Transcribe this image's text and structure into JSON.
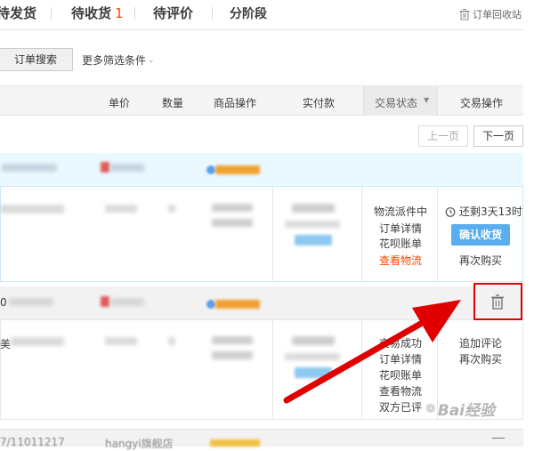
{
  "tabs": [
    {
      "label": "待发货",
      "count": ""
    },
    {
      "label": "待收货",
      "count": "1"
    },
    {
      "label": "待评价",
      "count": ""
    },
    {
      "label": "分阶段",
      "count": ""
    }
  ],
  "recycle_label": "订单回收站",
  "search_button": "订单搜索",
  "more_filters": "更多筛选条件",
  "columns": {
    "price": "单价",
    "qty": "数量",
    "product_ops": "商品操作",
    "paid": "实付款",
    "status": "交易状态",
    "ops": "交易操作"
  },
  "pager": {
    "prev": "上一页",
    "next": "下一页"
  },
  "order1": {
    "status_lines": [
      "物流派件中",
      "订单详情",
      "花呗账单",
      "查看物流"
    ],
    "countdown": "还剩3天13时",
    "confirm": "确认收货",
    "rebuy": "再次购买"
  },
  "order2": {
    "left_char": "0",
    "left_char2": "美",
    "status_lines": [
      "交易成功",
      "订单详情",
      "花呗账单",
      "查看物流",
      "双方已评"
    ],
    "add_review": "追加评论",
    "rebuy": "再次购买"
  },
  "order3": {
    "left_text": "7/11011217",
    "mid_text": "hangyi旗舰店"
  },
  "watermark": "Bai经验",
  "colors": {
    "accent": "#ff4400",
    "highlight": "#e00000",
    "confirm_btn": "#5aaef0",
    "row_bg": "#eaf8ff"
  }
}
